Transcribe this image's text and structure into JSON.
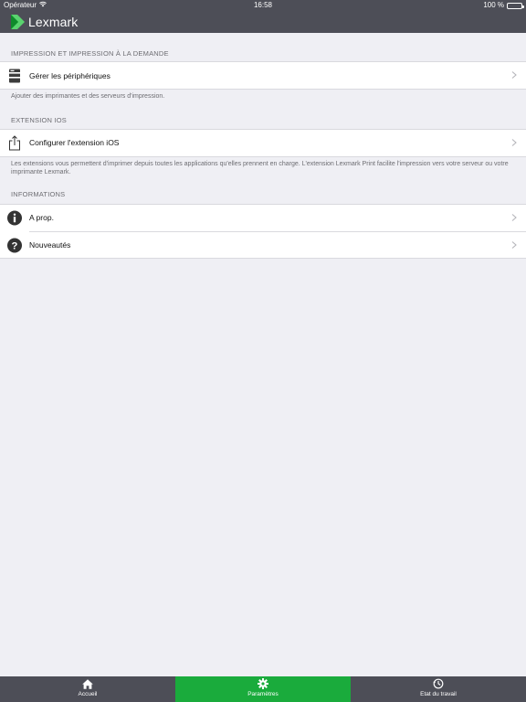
{
  "status_bar": {
    "carrier": "Opérateur",
    "time": "16:58",
    "battery": "100 %"
  },
  "header": {
    "brand": "Lexmark"
  },
  "sections": [
    {
      "title": "IMPRESSION ET IMPRESSION À LA DEMANDE",
      "rows": [
        {
          "label": "Gérer les périphériques",
          "icon": "printer-icon"
        }
      ],
      "footer": "Ajouter des imprimantes et des serveurs d'impression."
    },
    {
      "title": "EXTENSION IOS",
      "rows": [
        {
          "label": "Configurer l'extension iOS",
          "icon": "share-icon"
        }
      ],
      "footer": "Les extensions vous permettent d'imprimer depuis toutes les applications qu'elles prennent en charge. L'extension Lexmark Print facilite l'impression vers votre serveur ou votre imprimante Lexmark."
    },
    {
      "title": "INFORMATIONS",
      "rows": [
        {
          "label": "A prop.",
          "icon": "info-icon"
        },
        {
          "label": "Nouveautés",
          "icon": "question-icon"
        }
      ]
    }
  ],
  "tabbar": {
    "tabs": [
      {
        "label": "Accueil",
        "icon": "home-icon"
      },
      {
        "label": "Paramètres",
        "icon": "gear-icon",
        "active": true
      },
      {
        "label": "Etat du travail",
        "icon": "job-status-icon"
      }
    ]
  },
  "colors": {
    "header_bg": "#4d4e57",
    "accent_green": "#1aab3c",
    "background": "#efeff4"
  }
}
